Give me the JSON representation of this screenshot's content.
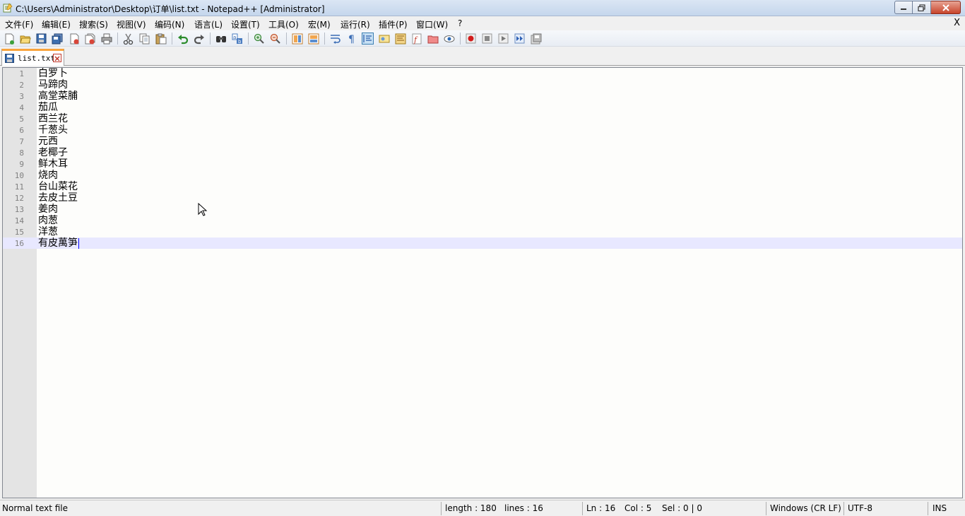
{
  "titlebar": {
    "title": "C:\\Users\\Administrator\\Desktop\\订单\\list.txt - Notepad++ [Administrator]"
  },
  "menu": {
    "items": [
      "文件(F)",
      "编辑(E)",
      "搜索(S)",
      "视图(V)",
      "编码(N)",
      "语言(L)",
      "设置(T)",
      "工具(O)",
      "宏(M)",
      "运行(R)",
      "插件(P)",
      "窗口(W)",
      "?"
    ],
    "close": "X"
  },
  "toolbar": {
    "icons": [
      "new-file-icon",
      "open-file-icon",
      "save-icon",
      "save-all-icon",
      "close-icon",
      "close-all-icon",
      "print-icon",
      "cut-icon",
      "copy-icon",
      "paste-icon",
      "undo-icon",
      "redo-icon",
      "find-icon",
      "replace-icon",
      "zoom-in-icon",
      "zoom-out-icon",
      "sync-vertical-icon",
      "sync-horizontal-icon",
      "word-wrap-icon",
      "show-all-chars-icon",
      "indent-guide-icon",
      "udl-icon",
      "doc-map-icon",
      "function-list-icon",
      "folder-workspace-icon",
      "monitoring-icon",
      "record-macro-icon",
      "stop-record-icon",
      "play-macro-icon",
      "run-macro-multiple-icon",
      "save-macro-icon"
    ]
  },
  "tab": {
    "label": "list.txt"
  },
  "editor": {
    "lines": [
      {
        "n": "1",
        "text": "白罗卜"
      },
      {
        "n": "2",
        "text": "马蹄肉"
      },
      {
        "n": "3",
        "text": "高堂菜脯"
      },
      {
        "n": "4",
        "text": "茄瓜"
      },
      {
        "n": "5",
        "text": "西兰花"
      },
      {
        "n": "6",
        "text": "千葱头"
      },
      {
        "n": "7",
        "text": "元西"
      },
      {
        "n": "8",
        "text": "老椰子"
      },
      {
        "n": "9",
        "text": "鲜木耳"
      },
      {
        "n": "10",
        "text": "烧肉"
      },
      {
        "n": "11",
        "text": "台山菜花"
      },
      {
        "n": "12",
        "text": "去皮土豆"
      },
      {
        "n": "13",
        "text": "姜肉"
      },
      {
        "n": "14",
        "text": "肉葱"
      },
      {
        "n": "15",
        "text": "洋葱"
      },
      {
        "n": "16",
        "text": "有皮萬笋"
      }
    ],
    "current_line": 16
  },
  "status": {
    "type": "Normal text file",
    "length": "length : 180",
    "lines": "lines : 16",
    "ln": "Ln : 16",
    "col": "Col : 5",
    "sel": "Sel : 0 | 0",
    "eol": "Windows (CR LF)",
    "encoding": "UTF-8",
    "mode": "INS"
  }
}
